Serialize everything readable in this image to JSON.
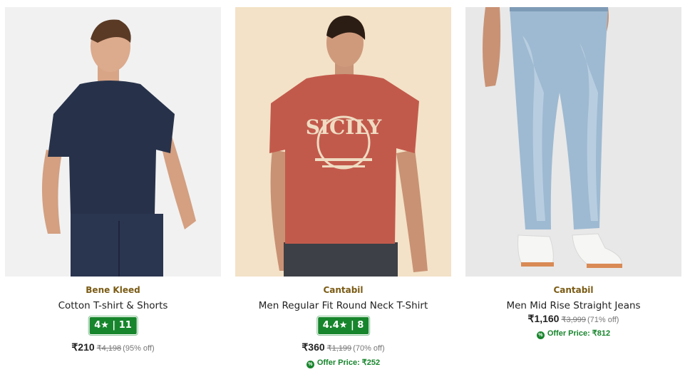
{
  "products": [
    {
      "brand": "Bene Kleed",
      "title": "Cotton T-shirt & Shorts",
      "rating": "4",
      "reviews": "11",
      "price": "₹210",
      "mrp": "₹4,198",
      "discount": "(95% off)",
      "image": "man-navy-tshirt-shorts-photo",
      "image_bg": "#f1f1f1"
    },
    {
      "brand": "Cantabil",
      "title": "Men Regular Fit Round Neck T-Shirt",
      "rating": "4.4",
      "reviews": "8",
      "price": "₹360",
      "mrp": "₹1,199",
      "discount": "(70% off)",
      "offer": "Offer Price: ₹252",
      "image": "man-red-sicily-tshirt-photo",
      "image_bg": "#f3e2c7",
      "shirt_print": "SICILY"
    },
    {
      "brand": "Cantabil",
      "title": "Men Mid Rise Straight Jeans",
      "price": "₹1,160",
      "mrp": "₹3,999",
      "discount": "(71% off)",
      "offer": "Offer Price: ₹812",
      "image": "man-light-blue-jeans-photo",
      "image_bg": "#e8e8e8"
    }
  ],
  "colors": {
    "brand": "#7a5b14",
    "rating_badge": "#17852c",
    "offer": "#17852c"
  },
  "icons": {
    "rating": "star-icon",
    "offer": "percent-badge-icon"
  }
}
